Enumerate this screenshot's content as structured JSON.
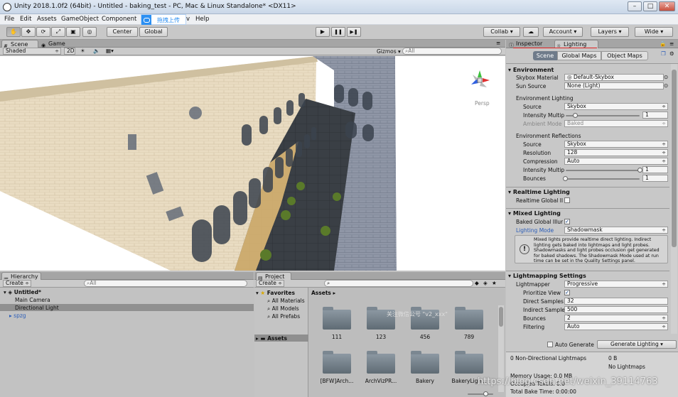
{
  "window": {
    "title": "Unity 2018.1.0f2 (64bit) - Untitled - baking_test - PC, Mac & Linux Standalone* <DX11>"
  },
  "menubar": {
    "items": [
      "File",
      "Edit",
      "Assets",
      "GameObject",
      "Component",
      "Window",
      "Help"
    ],
    "help": "Help",
    "upload_label": "拖拽上传",
    "partial_item": "v"
  },
  "toolbar": {
    "transform_tools": [
      "hand-tool",
      "move-tool",
      "rotate-tool",
      "scale-tool",
      "rect-tool",
      "transform-tool"
    ],
    "pivot": "Center",
    "space": "Global",
    "play": "▶",
    "pause": "❚❚",
    "step": "▶❚",
    "collab": "Collab",
    "account": "Account",
    "layers": "Layers",
    "layout": "Wide"
  },
  "scene_view": {
    "tabs": [
      "Scene",
      "Game"
    ],
    "shading": "Shaded",
    "mode_2d": "2D",
    "gizmos": "Gizmos",
    "search_placeholder": "All",
    "persp": "Persp"
  },
  "inspector_tabs": [
    "Inspector",
    "Lighting"
  ],
  "lighting": {
    "subtabs": [
      "Scene",
      "Global Maps",
      "Object Maps"
    ],
    "environment": {
      "header": "Environment",
      "skybox_label": "Skybox Material",
      "skybox_value": "Default-Skybox",
      "sun_label": "Sun Source",
      "sun_value": "None (Light)",
      "env_lighting": "Environment Lighting",
      "source_label": "Source",
      "source_value": "Skybox",
      "intensity_label": "Intensity Multip",
      "intensity_value": "1",
      "ambient_label": "Ambient Mode",
      "ambient_value": "Baked",
      "env_reflections": "Environment Reflections",
      "refl_source_label": "Source",
      "refl_source_value": "Skybox",
      "resolution_label": "Resolution",
      "resolution_value": "128",
      "compression_label": "Compression",
      "compression_value": "Auto",
      "refl_intensity_label": "Intensity Multip",
      "refl_intensity_value": "1",
      "bounces_label": "Bounces",
      "bounces_value": "1"
    },
    "realtime": {
      "header": "Realtime Lighting",
      "gi_label": "Realtime Global Il"
    },
    "mixed": {
      "header": "Mixed Lighting",
      "baked_gi_label": "Baked Global Illur",
      "mode_label": "Lighting Mode",
      "mode_value": "Shadowmask",
      "info": "Mixed lights provide realtime direct lighting. Indirect lighting gets baked into lightmaps and light probes. Shadowmasks and light probes occlusion get generated for baked shadows. The Shadowmask Mode used at run time can be set in the Quality Settings panel."
    },
    "lightmapping": {
      "header": "Lightmapping Settings",
      "lightmapper_label": "Lightmapper",
      "lightmapper_value": "Progressive",
      "prioritize_label": "Prioritize View",
      "direct_label": "Direct Samples",
      "direct_value": "32",
      "indirect_label": "Indirect Sample",
      "indirect_value": "500",
      "bounces_label": "Bounces",
      "bounces_value": "2",
      "filtering_label": "Filtering",
      "filtering_value": "Auto"
    },
    "auto_generate": "Auto Generate",
    "generate_button": "Generate Lighting",
    "stats": {
      "lightmaps": "0 Non-Directional Lightmaps",
      "size": "0 B",
      "no_lightmaps": "No Lightmaps",
      "memory": "Memory Usage: 0.0 MB",
      "occupied": "Occupied Texels: 0.0",
      "bake_time": "Total Bake Time: 0:00:00"
    }
  },
  "hierarchy": {
    "tab": "Hierarchy",
    "create": "Create",
    "search_placeholder": "All",
    "scene": "Untitled*",
    "items": [
      "Main Camera",
      "Directional Light",
      "spzg"
    ]
  },
  "project": {
    "tab": "Project",
    "create": "Create",
    "favorites": "Favorites",
    "fav_items": [
      "All Materials",
      "All Models",
      "All Prefabs"
    ],
    "assets_root": "Assets",
    "breadcrumb": "Assets",
    "folders": [
      "111",
      "123",
      "456",
      "789",
      "[BFW]Arch...",
      "ArchVizPR...",
      "Bakery",
      "BakeryLigh..."
    ]
  },
  "watermark": {
    "center": "关注微信公号 \"v2_xxx\"",
    "bottom": "https://blog.csdn.net/weixin_39114763"
  },
  "colors": {
    "accent_red": "#e02020",
    "selection_blue": "#3d6fb6",
    "link_blue": "#2b5db8"
  }
}
